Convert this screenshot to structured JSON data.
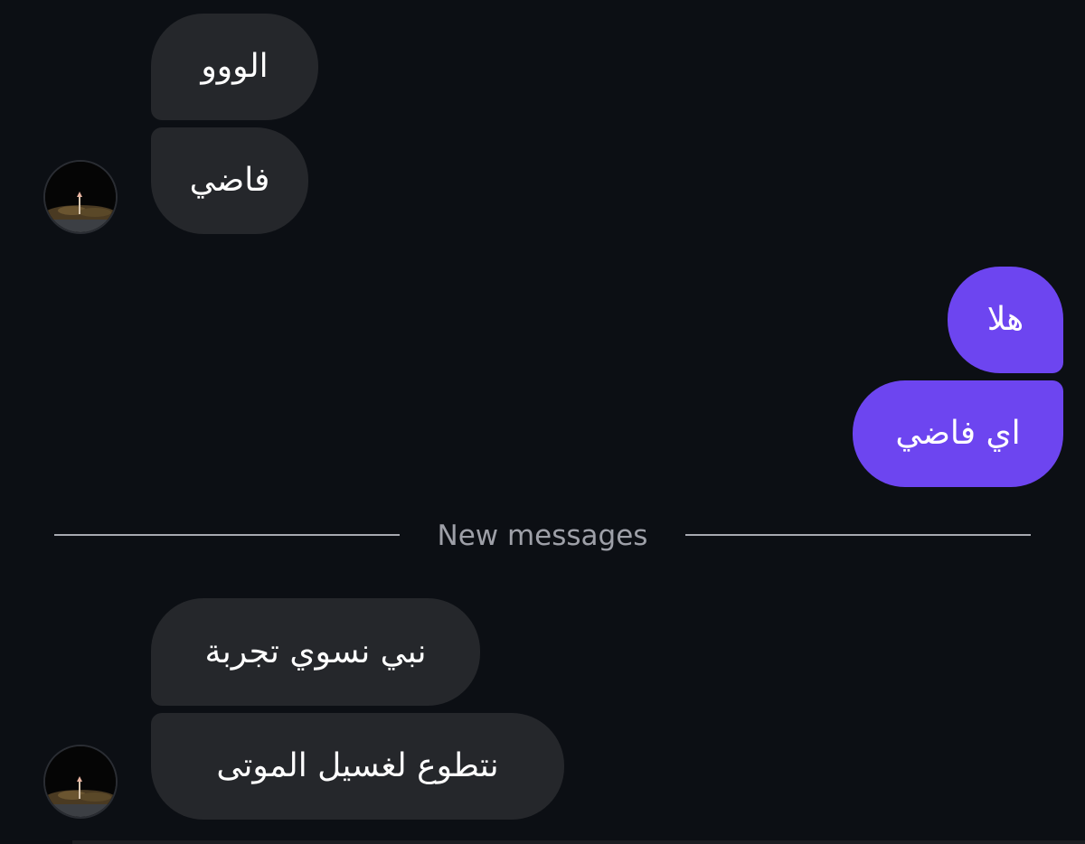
{
  "conversation": {
    "divider_label": "New messages",
    "messages": [
      {
        "sender": "contact",
        "text": "الووو"
      },
      {
        "sender": "contact",
        "text": "فاضي"
      },
      {
        "sender": "me",
        "text": "هلا"
      },
      {
        "sender": "me",
        "text": "اي فاضي"
      },
      {
        "sender": "contact",
        "text": "نبي نسوي تجربة"
      },
      {
        "sender": "contact",
        "text": "نتطوع لغسيل الموتى"
      }
    ]
  },
  "colors": {
    "background": "#0c0f14",
    "incoming_bubble": "#25272b",
    "outgoing_bubble": "#6d45f0",
    "divider": "#a7a9b0",
    "divider_text": "#9ea0a8"
  },
  "icons": {
    "avatar": "contact-avatar-photo"
  }
}
